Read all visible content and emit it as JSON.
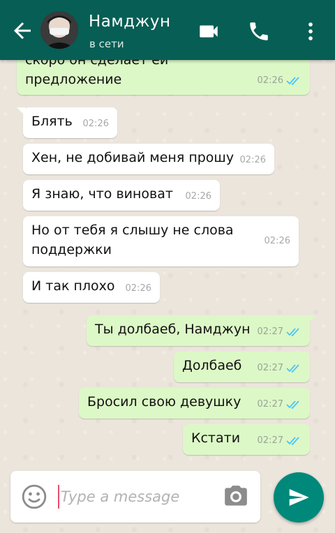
{
  "header": {
    "contact_name": "Намджун",
    "status": "в сети",
    "icons": [
      "back-arrow-icon",
      "video-call-icon",
      "phone-icon",
      "more-vert-icon"
    ],
    "color": "#075e54"
  },
  "messages": [
    {
      "direction": "out",
      "text_line1": "скоро он сделает ей",
      "text_line2": "предложение",
      "time": "02:26",
      "read": true
    },
    {
      "direction": "in",
      "text": "Блять",
      "time": "02:26"
    },
    {
      "direction": "in",
      "text": "Хен, не добивай меня прошу",
      "time": "02:26"
    },
    {
      "direction": "in",
      "text": "Я знаю, что виноват",
      "time": "02:26"
    },
    {
      "direction": "in",
      "text_line1": "Но от тебя я слышу не слова",
      "text_line2": "поддержки",
      "time": "02:26"
    },
    {
      "direction": "in",
      "text": "И так плохо",
      "time": "02:26"
    },
    {
      "direction": "out",
      "text": "Ты долбаеб, Намджун",
      "time": "02:27",
      "read": true
    },
    {
      "direction": "out",
      "text": "Долбаеб",
      "time": "02:27",
      "read": true
    },
    {
      "direction": "out",
      "text": "Бросил свою девушку",
      "time": "02:27",
      "read": true
    },
    {
      "direction": "out",
      "text": "Кстати",
      "time": "02:27",
      "read": true
    }
  ],
  "composer": {
    "placeholder": "Type a message",
    "icons": [
      "emoji-icon",
      "camera-icon",
      "send-icon"
    ],
    "send_color": "#00897b"
  },
  "colors": {
    "outgoing_bubble": "#dcf8c6",
    "incoming_bubble": "#ffffff",
    "read_ticks": "#4fc3f7"
  }
}
